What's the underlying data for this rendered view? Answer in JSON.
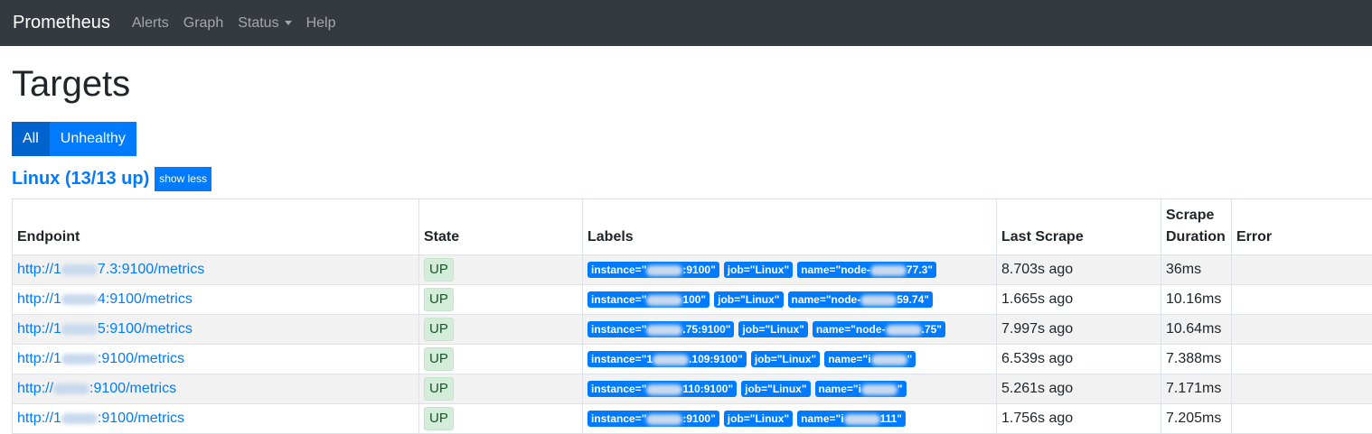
{
  "nav": {
    "brand": "Prometheus",
    "items": [
      {
        "label": "Alerts"
      },
      {
        "label": "Graph"
      },
      {
        "label": "Status"
      },
      {
        "label": "Help"
      }
    ]
  },
  "page": {
    "title": "Targets",
    "filters": [
      {
        "label": "All",
        "active": true
      },
      {
        "label": "Unhealthy",
        "active": false
      }
    ]
  },
  "job": {
    "title": "Linux (13/13 up)",
    "toggle_label": "show less",
    "columns": [
      "Endpoint",
      "State",
      "Labels",
      "Last Scrape",
      "Scrape Duration",
      "Error"
    ],
    "rows": [
      {
        "endpoint_prefix": "http://1",
        "endpoint_suffix": "7.3:9100/metrics",
        "state": "UP",
        "labels": [
          "instance=\"",
          ":9100\"",
          "job=\"Linux\"",
          "name=\"node-",
          "77.3\""
        ],
        "last_scrape": "8.703s ago",
        "duration": "36ms",
        "error": ""
      },
      {
        "endpoint_prefix": "http://1",
        "endpoint_suffix": "4:9100/metrics",
        "state": "UP",
        "labels": [
          "instance=\"",
          "100\"",
          "job=\"Linux\"",
          "name=\"node-",
          "59.74\""
        ],
        "last_scrape": "1.665s ago",
        "duration": "10.16ms",
        "error": ""
      },
      {
        "endpoint_prefix": "http://1",
        "endpoint_suffix": "5:9100/metrics",
        "state": "UP",
        "labels": [
          "instance=\"",
          ".75:9100\"",
          "job=\"Linux\"",
          "name=\"node-",
          ".75\""
        ],
        "last_scrape": "7.997s ago",
        "duration": "10.64ms",
        "error": ""
      },
      {
        "endpoint_prefix": "http://1",
        "endpoint_suffix": ":9100/metrics",
        "state": "UP",
        "labels": [
          "instance=\"1",
          ".109:9100\"",
          "job=\"Linux\"",
          "name=\"i",
          "\""
        ],
        "last_scrape": "6.539s ago",
        "duration": "7.388ms",
        "error": ""
      },
      {
        "endpoint_prefix": "http://",
        "endpoint_suffix": ":9100/metrics",
        "state": "UP",
        "labels": [
          "instance=\"",
          "110:9100\"",
          "job=\"Linux\"",
          "name=\"i",
          "\""
        ],
        "last_scrape": "5.261s ago",
        "duration": "7.171ms",
        "error": ""
      },
      {
        "endpoint_prefix": "http://1",
        "endpoint_suffix": ":9100/metrics",
        "state": "UP",
        "labels": [
          "instance=\"",
          ":9100\"",
          "job=\"Linux\"",
          "name=\"i",
          "111\""
        ],
        "last_scrape": "1.756s ago",
        "duration": "7.205ms",
        "error": ""
      }
    ]
  },
  "colors": {
    "navbar": "#343a40",
    "primary": "#007bff",
    "up_bg": "#d4edda"
  }
}
